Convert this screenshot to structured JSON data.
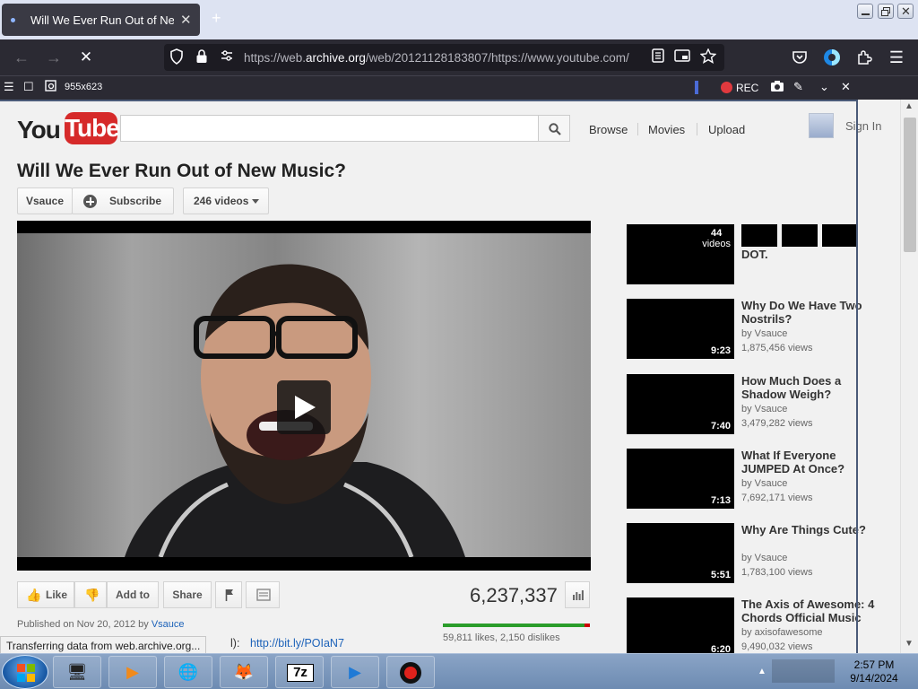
{
  "browser": {
    "tab_title": "Will We Ever Run Out of New M",
    "url_prefix": "https://web.",
    "url_domain": "archive.org",
    "url_rest": "/web/20121128183807/https://www.youtube.com/",
    "rdm_dimensions": "955x623",
    "rec_label": "REC"
  },
  "youtube": {
    "logo_you": "You",
    "logo_tube": "Tube",
    "search_placeholder": "",
    "nav": {
      "browse": "Browse",
      "movies": "Movies",
      "upload": "Upload"
    },
    "sign_in": "Sign In",
    "video_title": "Will We Ever Run Out of New Music?",
    "channel": "Vsauce",
    "subscribe": "Subscribe",
    "videos_count": "246 videos",
    "actions": {
      "like": "Like",
      "add_to": "Add to",
      "share": "Share"
    },
    "view_count": "6,237,337",
    "likes_text": "59,811 likes, 2,150 dislikes",
    "like_ratio": 0.965,
    "published_prefix": "Published on Nov 20, 2012 by ",
    "published_by": "Vsauce",
    "desc_prefix": "l):",
    "desc_link": "http://bit.ly/POIaN7",
    "sidebar": [
      {
        "title": "DOT.",
        "duration": "",
        "badge_count": "44",
        "badge_label": "videos",
        "by": "",
        "views": ""
      },
      {
        "title": "Why Do We Have Two Nostrils?",
        "duration": "9:23",
        "by": "by Vsauce",
        "views": "1,875,456 views"
      },
      {
        "title": "How Much Does a Shadow Weigh?",
        "duration": "7:40",
        "by": "by Vsauce",
        "views": "3,479,282 views"
      },
      {
        "title": "What If Everyone JUMPED At Once?",
        "duration": "7:13",
        "by": "by Vsauce",
        "views": "7,692,171 views"
      },
      {
        "title": "Why Are Things Cute?",
        "duration": "5:51",
        "by": "by Vsauce",
        "views": "1,783,100 views"
      },
      {
        "title": "The Axis of Awesome: 4 Chords Official Music",
        "duration": "6:20",
        "by": "by axisofawesome",
        "views": "9,490,032 views"
      }
    ]
  },
  "status_text": "Transferring data from web.archive.org...",
  "taskbar": {
    "time": "2:57 PM",
    "date": "9/14/2024"
  },
  "colors": {
    "youtube_red": "#d62a2a",
    "link_blue": "#1c62b9",
    "like_green": "#2a9d2a",
    "browser_dark": "#2b2a33",
    "rec_red": "#e0393e"
  }
}
